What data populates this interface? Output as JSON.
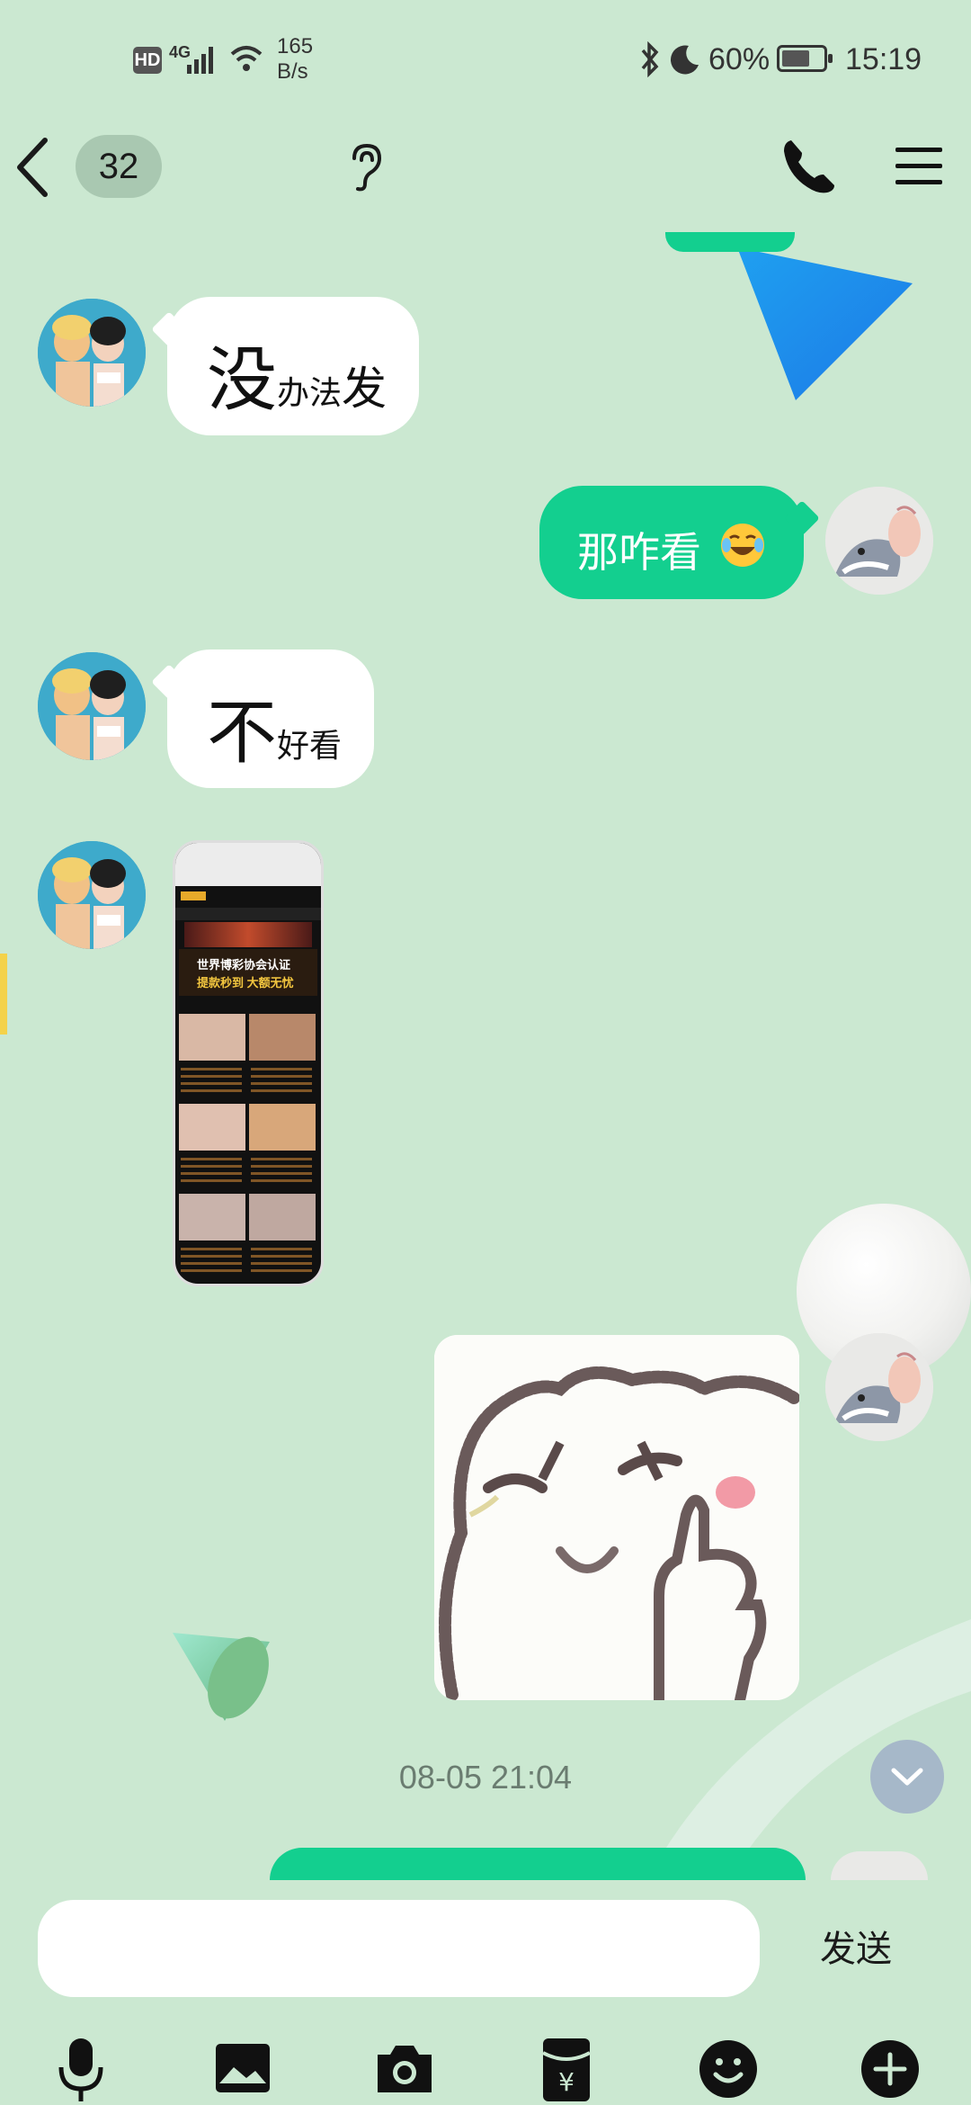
{
  "status_bar": {
    "hd_label": "HD",
    "network_label": "4G",
    "speed_value": "165",
    "speed_unit": "B/s",
    "battery_percent": "60%",
    "time": "15:19"
  },
  "header": {
    "unread_count": "32"
  },
  "messages": [
    {
      "side": "in",
      "big": "没",
      "small": "办法",
      "tail": "发"
    },
    {
      "side": "out",
      "text": "那咋看",
      "emoji": "face-with-tears-of-joy"
    },
    {
      "side": "in",
      "big": "不",
      "small": "好看"
    },
    {
      "side": "in",
      "type": "image",
      "content": "screenshot"
    },
    {
      "side": "out",
      "type": "sticker",
      "content": "bear-thumbs-up"
    }
  ],
  "screenshot_card": {
    "line1": "世界博彩协会认证",
    "line2": "提款秒到 大额无忧"
  },
  "timestamp": "08-05 21:04",
  "input": {
    "value": "",
    "send_label": "发送"
  },
  "colors": {
    "background": "#cbe8d1",
    "outgoing_bubble": "#13cf8f",
    "incoming_bubble": "#ffffff"
  },
  "toolbar_icons": [
    "microphone-icon",
    "image-icon",
    "camera-icon",
    "red-packet-icon",
    "emoji-icon",
    "plus-icon"
  ]
}
